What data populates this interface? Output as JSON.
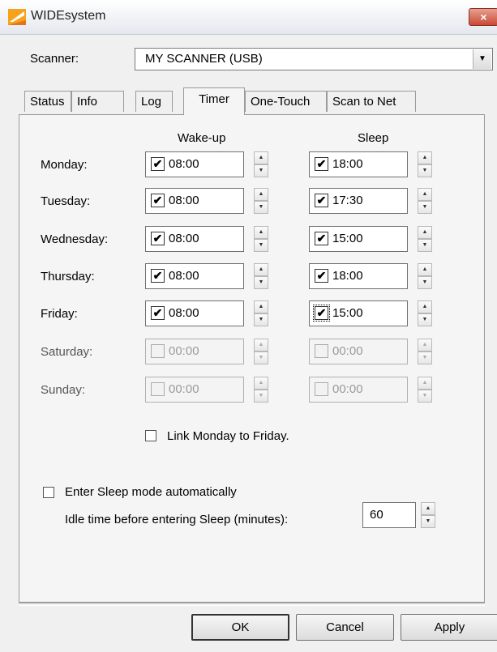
{
  "window": {
    "title": "WIDEsystem",
    "close": "×"
  },
  "scanner": {
    "label": "Scanner:",
    "value": "MY SCANNER (USB)",
    "arrow": "▼"
  },
  "tabs": [
    {
      "label": "Status"
    },
    {
      "label": "Info"
    },
    {
      "label": "Log"
    },
    {
      "label": "Timer",
      "active": true
    },
    {
      "label": "One-Touch"
    },
    {
      "label": "Scan to Net"
    }
  ],
  "timer": {
    "wake_header": "Wake-up",
    "sleep_header": "Sleep",
    "days": [
      {
        "label": "Monday:",
        "wake": "08:00",
        "wake_checked": true,
        "sleep": "18:00",
        "sleep_checked": true,
        "enabled": true
      },
      {
        "label": "Tuesday:",
        "wake": "08:00",
        "wake_checked": true,
        "sleep": "17:30",
        "sleep_checked": true,
        "enabled": true
      },
      {
        "label": "Wednesday:",
        "wake": "08:00",
        "wake_checked": true,
        "sleep": "15:00",
        "sleep_checked": true,
        "enabled": true
      },
      {
        "label": "Thursday:",
        "wake": "08:00",
        "wake_checked": true,
        "sleep": "18:00",
        "sleep_checked": true,
        "enabled": true
      },
      {
        "label": "Friday:",
        "wake": "08:00",
        "wake_checked": true,
        "sleep": "15:00",
        "sleep_checked": true,
        "enabled": true
      },
      {
        "label": "Saturday:",
        "wake": "00:00",
        "wake_checked": false,
        "sleep": "00:00",
        "sleep_checked": false,
        "enabled": false
      },
      {
        "label": "Sunday:",
        "wake": "00:00",
        "wake_checked": false,
        "sleep": "00:00",
        "sleep_checked": false,
        "enabled": false
      }
    ],
    "link_label": "Link Monday to Friday.",
    "link_checked": false,
    "sleep_auto_label": "Enter Sleep mode automatically",
    "sleep_auto_checked": false,
    "idle_label": "Idle time before entering Sleep (minutes):",
    "idle_value": "60"
  },
  "buttons": {
    "ok": "OK",
    "cancel": "Cancel",
    "apply": "Apply"
  },
  "glyphs": {
    "check": "✔",
    "up": "▲",
    "down": "▼"
  }
}
